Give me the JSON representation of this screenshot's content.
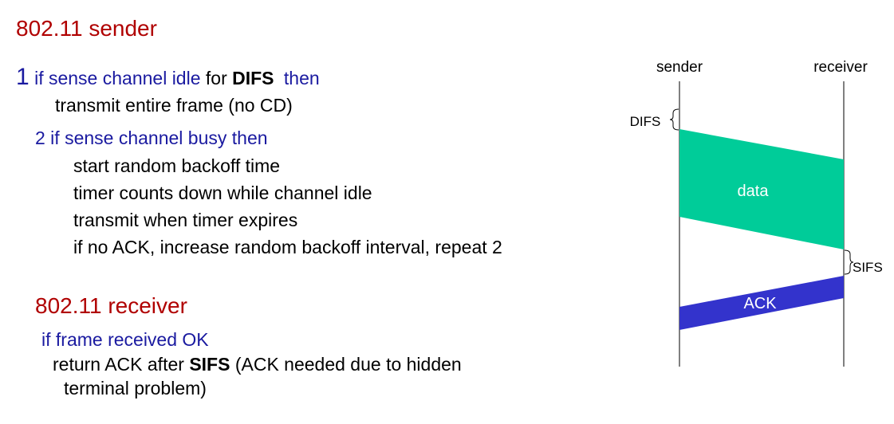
{
  "sender": {
    "title": "802.11 sender",
    "step1": {
      "num": "1",
      "prefix": "if sense channel idle",
      "for": "for",
      "difs": "DIFS",
      "then": "then"
    },
    "step1_action": "transmit entire frame (no CD)",
    "step2": "2 if sense channel busy then",
    "step2_actions": [
      "start random backoff time",
      "timer counts down while channel idle",
      "transmit when timer expires",
      "if no ACK, increase random backoff interval, repeat 2"
    ]
  },
  "receiver": {
    "title": "802.11 receiver",
    "cond": "if frame received OK",
    "ret_prefix": "return ACK after",
    "sifs": "SIFS",
    "ret_suffix": "(ACK needed due to hidden",
    "ret_cont": "terminal problem)"
  },
  "diagram": {
    "sender_label": "sender",
    "receiver_label": "receiver",
    "difs_label": "DIFS",
    "data_label": "data",
    "sifs_label": "SIFS",
    "ack_label": "ACK",
    "colors": {
      "data": "#00cc99",
      "ack": "#3333cc"
    }
  }
}
